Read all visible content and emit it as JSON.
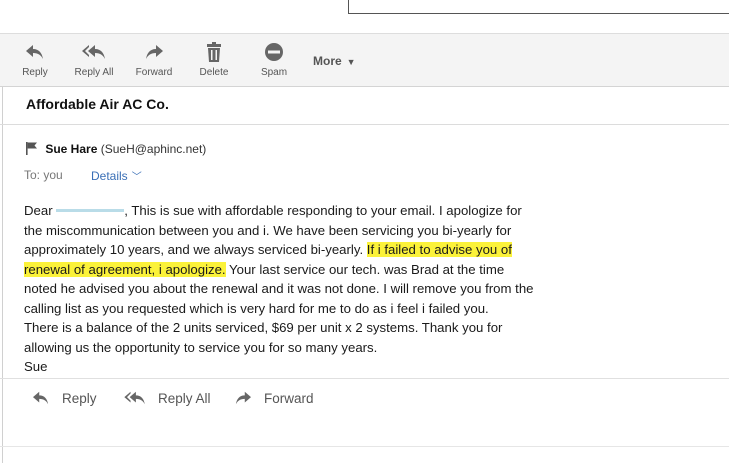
{
  "toolbar": {
    "reply": "Reply",
    "reply_all": "Reply All",
    "forward": "Forward",
    "delete": "Delete",
    "spam": "Spam",
    "more": "More"
  },
  "subject": "Affordable Air AC Co.",
  "sender": {
    "name": "Sue Hare",
    "email": "(SueH@aphinc.net)"
  },
  "recipient": {
    "to_label": "To:",
    "to_value": "you",
    "details_label": "Details"
  },
  "body": {
    "l1_a": "Dear",
    "l1_b": ",  This is sue with affordable responding to your email.  I apologize for",
    "l2": "the miscommunication between you and i.  We have been servicing you bi-yearly for",
    "l3_a": "approximately 10 years, and we always serviced bi-yearly.  ",
    "l3_hl": "If i failed to advise you of",
    "l4_hl": "renewal of agreement, i apologize.",
    "l4_b": " Your last service our  tech. was Brad at the time",
    "l5": "noted he advised you about the renewal and it was not done. I will remove you from the",
    "l6": "calling list as you requested which is very hard for me to do as i feel i failed you.",
    "l7": "There is a balance of the 2 units serviced, $69 per unit x 2 systems.   Thank you for",
    "l8": "allowing us the opportunity to service you for so many years.",
    "l9": "Sue"
  },
  "footer": {
    "reply": "Reply",
    "reply_all": "Reply All",
    "forward": "Forward"
  },
  "colors": {
    "highlight": "#fbf23a",
    "link": "#3a6fb6",
    "icon": "#666666"
  }
}
